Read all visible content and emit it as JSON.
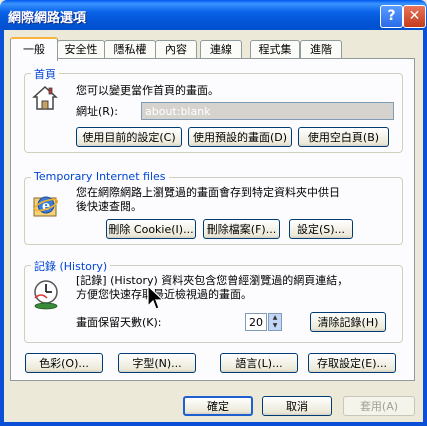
{
  "window": {
    "title": "網際網路選項"
  },
  "tabs": [
    {
      "label": "一般"
    },
    {
      "label": "安全性"
    },
    {
      "label": "隱私權"
    },
    {
      "label": "內容"
    },
    {
      "label": "連線"
    },
    {
      "label": "程式集"
    },
    {
      "label": "進階"
    }
  ],
  "homepage": {
    "group_label": "首頁",
    "description": "您可以變更當作首頁的畫面。",
    "address_label": "網址(R):",
    "address_value": "about:blank",
    "btn_current": "使用目前的設定(C)",
    "btn_default": "使用預設的畫面(D)",
    "btn_blank": "使用空白頁(B)"
  },
  "temp_files": {
    "group_label": "Temporary Internet files",
    "description_line1": "您在網際網路上瀏覽過的畫面會存到特定資料夾中供日",
    "description_line2": "後快速查閱。",
    "btn_delete_cookies": "刪除 Cookie(I)...",
    "btn_delete_files": "刪除檔案(F)...",
    "btn_settings": "設定(S)..."
  },
  "history": {
    "group_label": "記錄 (History)",
    "description_line1": "[記錄] (History) 資料夾包含您曾經瀏覽過的網頁連結，",
    "description_line2": "方便您快速存取最近檢視過的畫面。",
    "days_label": "畫面保留天數(K):",
    "days_value": "20",
    "btn_clear": "清除記錄(H)"
  },
  "bottom_buttons": {
    "colors": "色彩(O)...",
    "fonts": "字型(N)...",
    "languages": "語言(L)...",
    "accessibility": "存取設定(E)..."
  },
  "dialog_buttons": {
    "ok": "確定",
    "cancel": "取消",
    "apply": "套用(A)"
  }
}
